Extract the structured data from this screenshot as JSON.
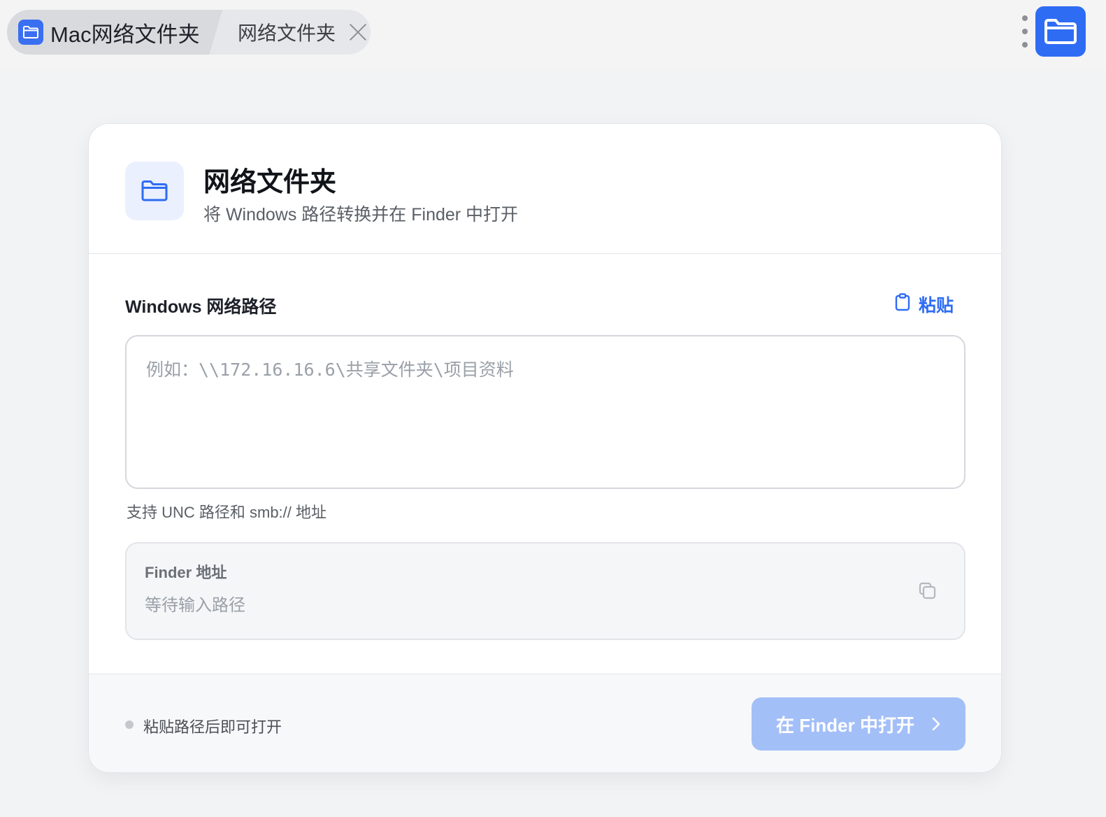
{
  "tabs": {
    "main_title": "Mac网络文件夹",
    "second_title": "网络文件夹"
  },
  "header": {
    "title": "网络文件夹",
    "subtitle": "将 Windows 路径转换并在 Finder 中打开"
  },
  "input_section": {
    "label": "Windows 网络路径",
    "paste_label": "粘贴",
    "value": "",
    "placeholder": "例如：\\\\172.16.16.6\\共享文件夹\\项目资料",
    "hint": "支持 UNC 路径和 smb:// 地址"
  },
  "finder": {
    "label": "Finder 地址",
    "value": "等待输入路径"
  },
  "footer": {
    "status": "粘贴路径后即可打开",
    "open_button": "在 Finder 中打开"
  },
  "icons": {
    "app": "folder-icon",
    "tab_close": "close-icon",
    "more": "more-vertical-icon",
    "paste": "clipboard-icon",
    "copy": "copy-icon",
    "chevron": "chevron-right-icon"
  },
  "colors": {
    "accent": "#2f6cf4",
    "accent_disabled": "#a3bff8",
    "background": "#f2f3f5"
  }
}
